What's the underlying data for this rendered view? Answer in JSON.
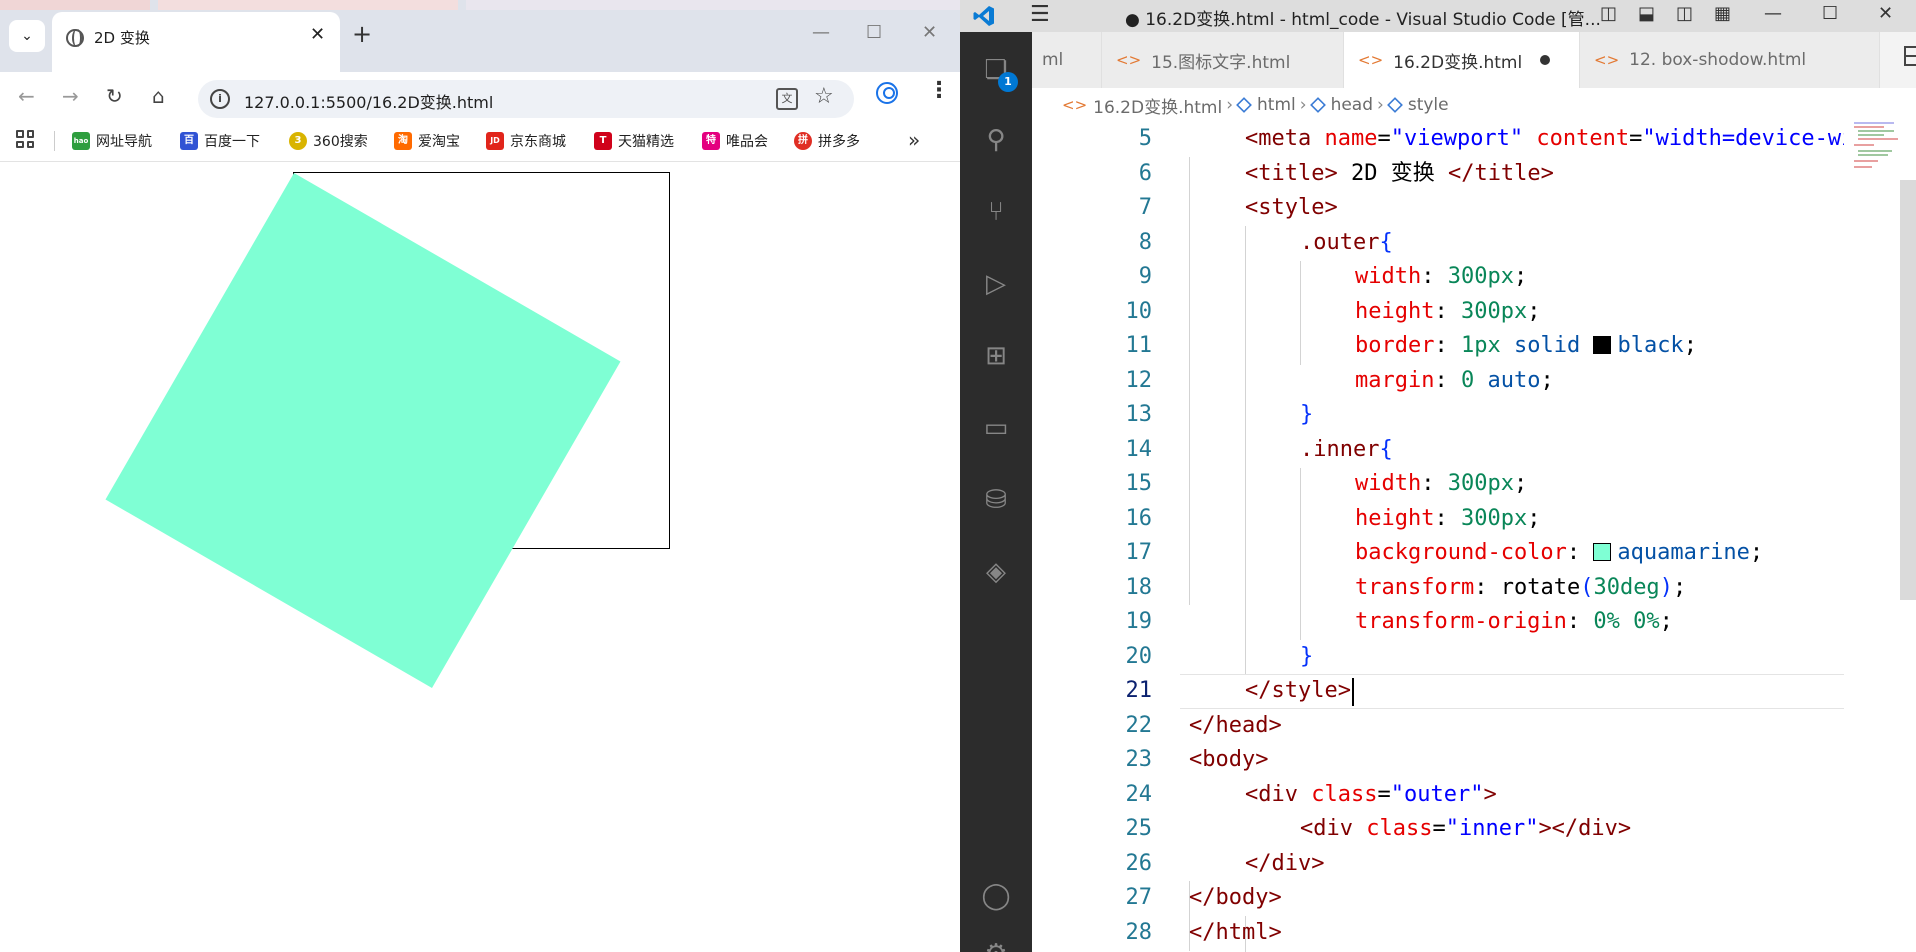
{
  "browser": {
    "active_tab_title": "2D 变换",
    "url": "127.0.0.1:5500/16.2D变换.html",
    "bookmarks": [
      "网址导航",
      "百度一下",
      "360搜索",
      "爱淘宝",
      "京东商城",
      "天猫精选",
      "唯品会",
      "拼多多"
    ],
    "bookmark_icon_glyphs": [
      "hao",
      "百",
      "3",
      "淘",
      "JD",
      "T",
      "特",
      "拼"
    ],
    "bookmark_icon_colors": [
      "#2e9e3e",
      "#3153d4",
      "#d9b400",
      "#ff6a00",
      "#e1251b",
      "#d0021b",
      "#e4007f",
      "#e02e24"
    ],
    "inner_color": "#7fffd4"
  },
  "vscode": {
    "title": "● 16.2D变换.html - html_code - Visual Studio Code [管...",
    "activity_badge": "1",
    "tabs": [
      {
        "label": "ml"
      },
      {
        "label": "15.图标文字.html"
      },
      {
        "label": "16.2D变换.html"
      },
      {
        "label": "12. box-shodow.html"
      }
    ],
    "breadcrumb": {
      "file": "16.2D变换.html",
      "items": [
        "html",
        "head",
        "style"
      ]
    },
    "line_numbers": [
      "5",
      "6",
      "7",
      "8",
      "9",
      "10",
      "11",
      "12",
      "13",
      "14",
      "15",
      "16",
      "17",
      "18",
      "19",
      "20",
      "21",
      "22",
      "23",
      "24",
      "25",
      "26",
      "27",
      "28"
    ],
    "code": {
      "l5": {
        "open": "<meta ",
        "name_attr": "name",
        "eq1": "=",
        "name_val": "\"viewport\"",
        "content_attr": " content",
        "eq2": "=",
        "content_val": "\"width=device-wi"
      },
      "l6": {
        "open": "<title>",
        "text": " 2D 变换 ",
        "close": "</title>"
      },
      "l7": {
        "tag": "<style>"
      },
      "l8": {
        "sel": ".outer",
        "brace": "{"
      },
      "l9": {
        "prop": "width",
        "colon": ": ",
        "val": "300px",
        "semi": ";"
      },
      "l10": {
        "prop": "height",
        "colon": ": ",
        "val": "300px",
        "semi": ";"
      },
      "l11": {
        "prop": "border",
        "colon": ": ",
        "num": "1px",
        "kw1": " solid ",
        "kw2": "black",
        "semi": ";"
      },
      "l12": {
        "prop": "margin",
        "colon": ": ",
        "num": "0",
        "kw": " auto",
        "semi": ";"
      },
      "l13": {
        "brace": "}"
      },
      "l14": {
        "sel": ".inner",
        "brace": "{"
      },
      "l15": {
        "prop": "width",
        "colon": ": ",
        "val": "300px",
        "semi": ";"
      },
      "l16": {
        "prop": "height",
        "colon": ": ",
        "val": "300px",
        "semi": ";"
      },
      "l17": {
        "prop": "background-color",
        "colon": ": ",
        "kw": "aquamarine",
        "semi": ";"
      },
      "l18": {
        "prop": "transform",
        "colon": ": ",
        "fn": "rotate",
        "paren_open": "(",
        "num": "30deg",
        "paren_close": ")",
        "semi": ";"
      },
      "l19": {
        "prop": "transform-origin",
        "colon": ": ",
        "num": "0% 0%",
        "semi": ";"
      },
      "l20": {
        "brace": "}"
      },
      "l21": {
        "tag": "</style>"
      },
      "l22": {
        "tag": "</head>"
      },
      "l23": {
        "tag": "<body>"
      },
      "l24": {
        "open": "<div ",
        "attr": "class",
        "eq": "=",
        "val": "\"outer\"",
        "close": ">"
      },
      "l25": {
        "open": "<div ",
        "attr": "class",
        "eq": "=",
        "val": "\"inner\"",
        "close": "></div>"
      },
      "l26": {
        "tag": "</div>"
      },
      "l27": {
        "tag": "</body>"
      },
      "l28": {
        "tag": "</html>"
      }
    }
  }
}
